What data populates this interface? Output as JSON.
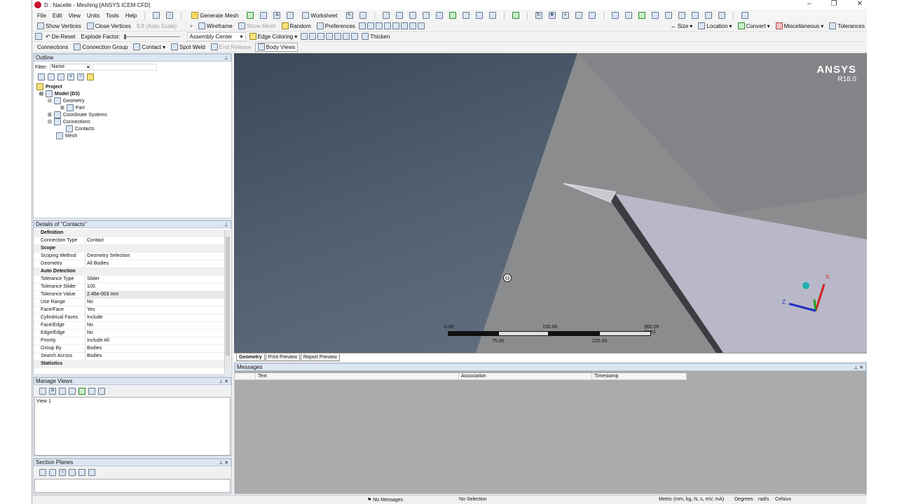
{
  "window": {
    "title": "D : Nacelle - Meshing [ANSYS ICEM CFD]",
    "controls": [
      "–",
      "❐",
      "✕"
    ]
  },
  "menu": [
    "File",
    "Edit",
    "View",
    "Units",
    "Tools",
    "Help"
  ],
  "toolbar1": {
    "generate_mesh": "Generate Mesh",
    "worksheet": "Worksheet"
  },
  "toolbar2": {
    "show_vertices": "Show Vertices",
    "close_vertices": "Close Vertices",
    "auto_scale": "9.8 (Auto Scale)",
    "wireframe": "Wireframe",
    "show_mesh": "Show Mesh",
    "random": "Random",
    "preferences": "Preferences",
    "size": "Size",
    "location": "Location",
    "convert": "Convert",
    "miscellaneous": "Miscellaneous",
    "tolerances": "Tolerances"
  },
  "toolbar3": {
    "reset": "De-Reset",
    "explode_factor": "Explode Factor:",
    "assembly_center": "Assembly Center",
    "edge_coloring": "Edge Coloring",
    "thicken": "Thicken"
  },
  "toolbar4": {
    "connections": "Connections",
    "connection_group": "Connection Group",
    "contact": "Contact",
    "spot_weld": "Spot Weld",
    "end_release": "End Release",
    "body_views": "Body Views"
  },
  "outline": {
    "title": "Outline",
    "filter_label": "Filter:",
    "filter_value": "Name",
    "tree": [
      {
        "label": "Project",
        "level": 0,
        "bold": true
      },
      {
        "label": "Model (D3)",
        "level": 1,
        "bold": true
      },
      {
        "label": "Geometry",
        "level": 2
      },
      {
        "label": "Part",
        "level": 3
      },
      {
        "label": "Coordinate Systems",
        "level": 2
      },
      {
        "label": "Connections",
        "level": 2
      },
      {
        "label": "Contacts",
        "level": 3
      },
      {
        "label": "Mesh",
        "level": 2
      }
    ]
  },
  "details": {
    "title": "Details of \"Contacts\"",
    "rows": [
      {
        "section": "Definition"
      },
      {
        "key": "Connection Type",
        "value": "Contact"
      },
      {
        "section": "Scope"
      },
      {
        "key": "Scoping Method",
        "value": "Geometry Selection"
      },
      {
        "key": "Geometry",
        "value": "All Bodies"
      },
      {
        "section": "Auto Detection"
      },
      {
        "key": "Tolerance Type",
        "value": "Slider"
      },
      {
        "key": "Tolerance Slider",
        "value": "100."
      },
      {
        "key": "Tolerance Value",
        "value": "2.46e-003 mm",
        "highlight": true
      },
      {
        "key": "Use Range",
        "value": "No"
      },
      {
        "key": "Face/Face",
        "value": "Yes"
      },
      {
        "key": "Cylindrical Faces",
        "value": "Include"
      },
      {
        "key": "Face/Edge",
        "value": "No"
      },
      {
        "key": "Edge/Edge",
        "value": "No"
      },
      {
        "key": "Priority",
        "value": "Include All"
      },
      {
        "key": "Group By",
        "value": "Bodies"
      },
      {
        "key": "Search Across",
        "value": "Bodies"
      },
      {
        "section": "Statistics"
      }
    ]
  },
  "manage_views": {
    "title": "Manage Views",
    "items": [
      "View 1"
    ]
  },
  "section_planes": {
    "title": "Section Planes"
  },
  "viewport": {
    "brand": "ANSYS",
    "version": "R18.0",
    "scale_labels_top": [
      "0.00",
      "150.00",
      "300.00 (mm)"
    ],
    "scale_labels_bottom": [
      "75.00",
      "225.00"
    ],
    "axis_x": "X",
    "axis_z": "Z",
    "axis_colors": {
      "x": "#d62020",
      "y": "#1aa01a",
      "z": "#2030c0"
    },
    "part_color": "#b8b8c8"
  },
  "view_tabs": [
    "Geometry",
    "Print Preview",
    "Report Preview"
  ],
  "messages": {
    "title": "Messages",
    "columns": [
      "Text",
      "Association",
      "Timestamp"
    ]
  },
  "status": {
    "messages": "No Messages",
    "selection": "No Selection",
    "units": "Metric (mm, kg, N, s, mV, mA)",
    "angle": "Degrees",
    "rate": "rad/s",
    "temperature": "Celsius"
  }
}
